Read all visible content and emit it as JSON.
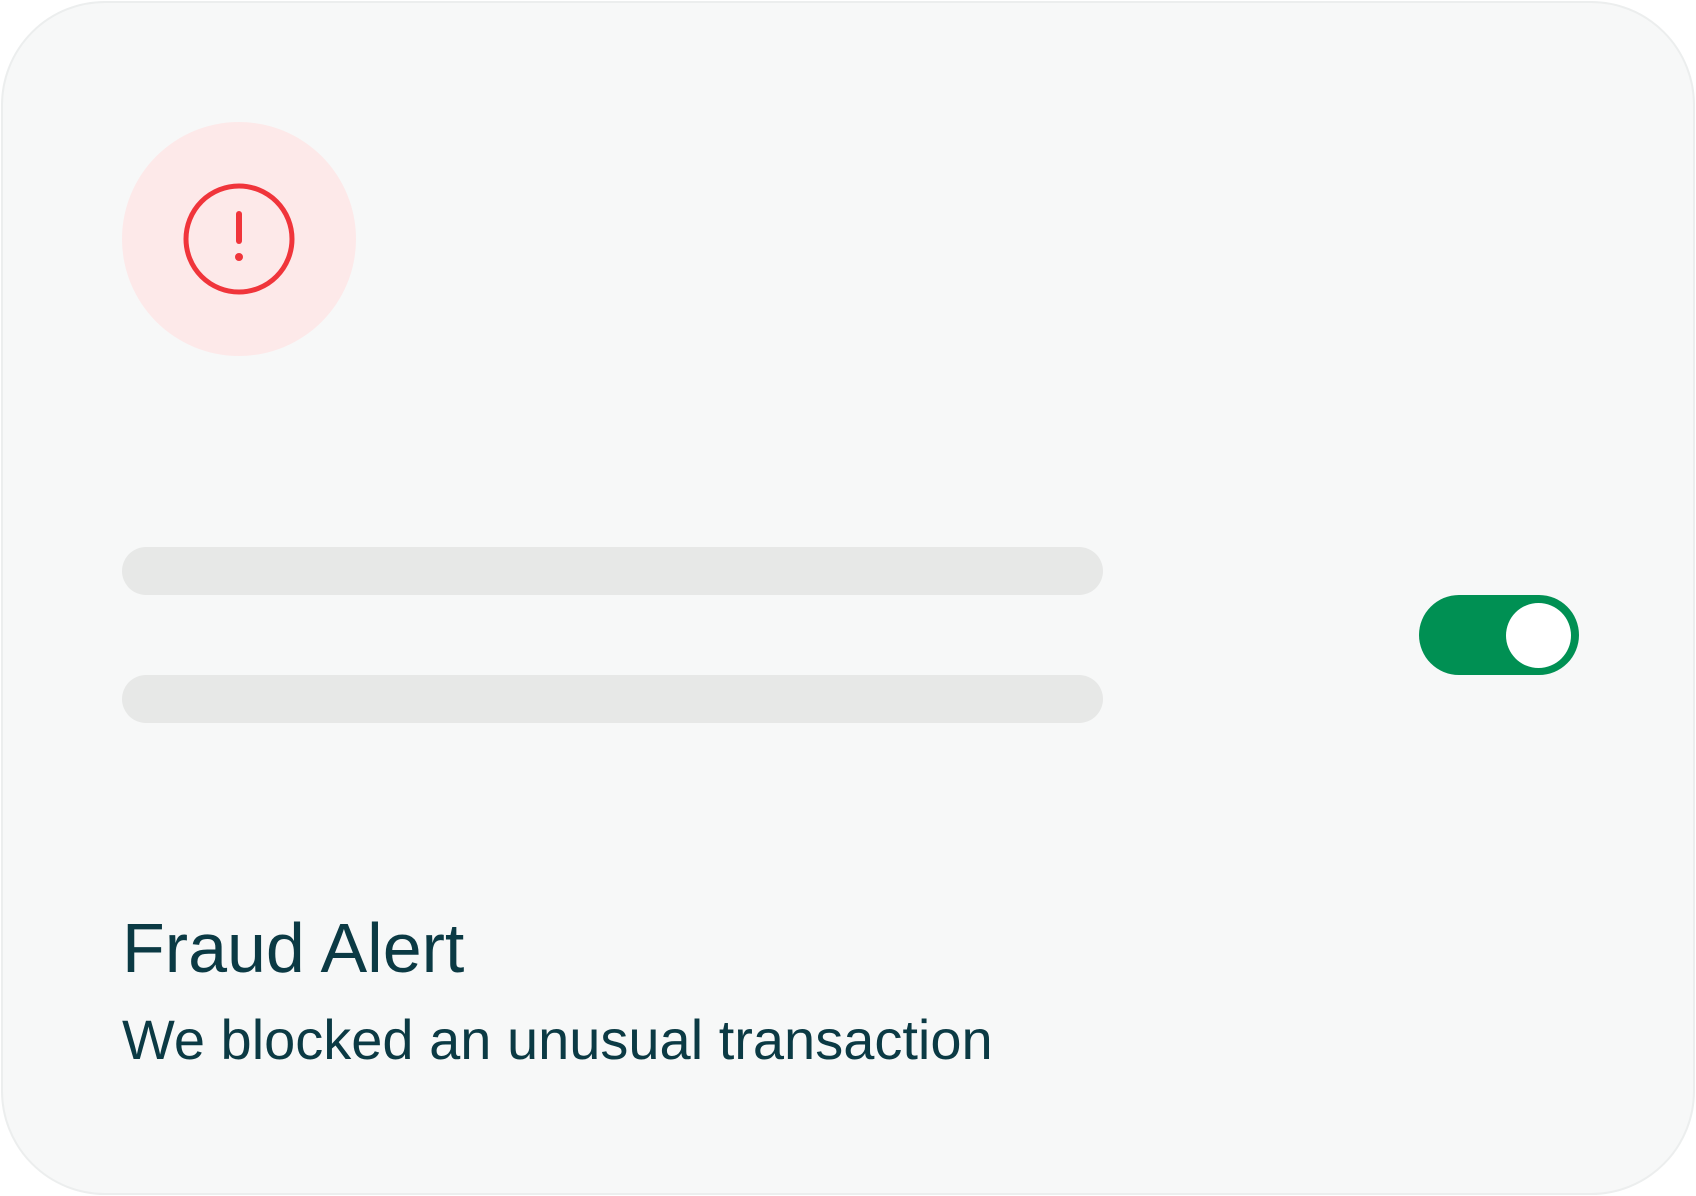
{
  "alert": {
    "icon": "alert-circle-icon",
    "icon_color": "#f0353b",
    "badge_color": "#fde9e9",
    "title": "Fraud Alert",
    "message": "We blocked an unusual transaction"
  },
  "toggle": {
    "state": "on",
    "color": "#009053"
  },
  "placeholder_lines": 2
}
